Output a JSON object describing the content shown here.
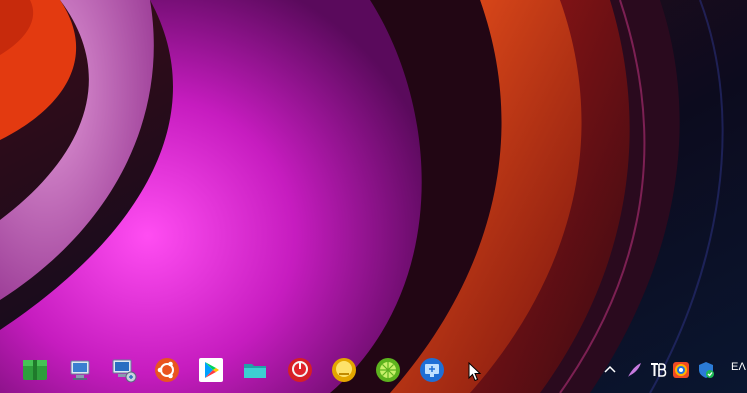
{
  "taskbar": {
    "pinned_apps": [
      {
        "id": "green-package-app"
      },
      {
        "id": "network-computer-app"
      },
      {
        "id": "remote-desktop-app"
      },
      {
        "id": "ubuntu-app"
      },
      {
        "id": "google-play-app"
      },
      {
        "id": "file-folder-app"
      },
      {
        "id": "red-power-app"
      },
      {
        "id": "yellow-app"
      },
      {
        "id": "lime-app"
      },
      {
        "id": "blue-screen-app"
      }
    ],
    "tray": {
      "items": [
        "chevron-up-icon",
        "feather-icon",
        "tb-icon",
        "colorful-app-icon",
        "security-shield-icon"
      ],
      "language": "ΕΛ"
    }
  },
  "colors": {
    "wallpaper_dark": "#0b0a1c",
    "magenta": "#d41ccc",
    "orange": "#e0401a",
    "pink": "#c964b9"
  }
}
